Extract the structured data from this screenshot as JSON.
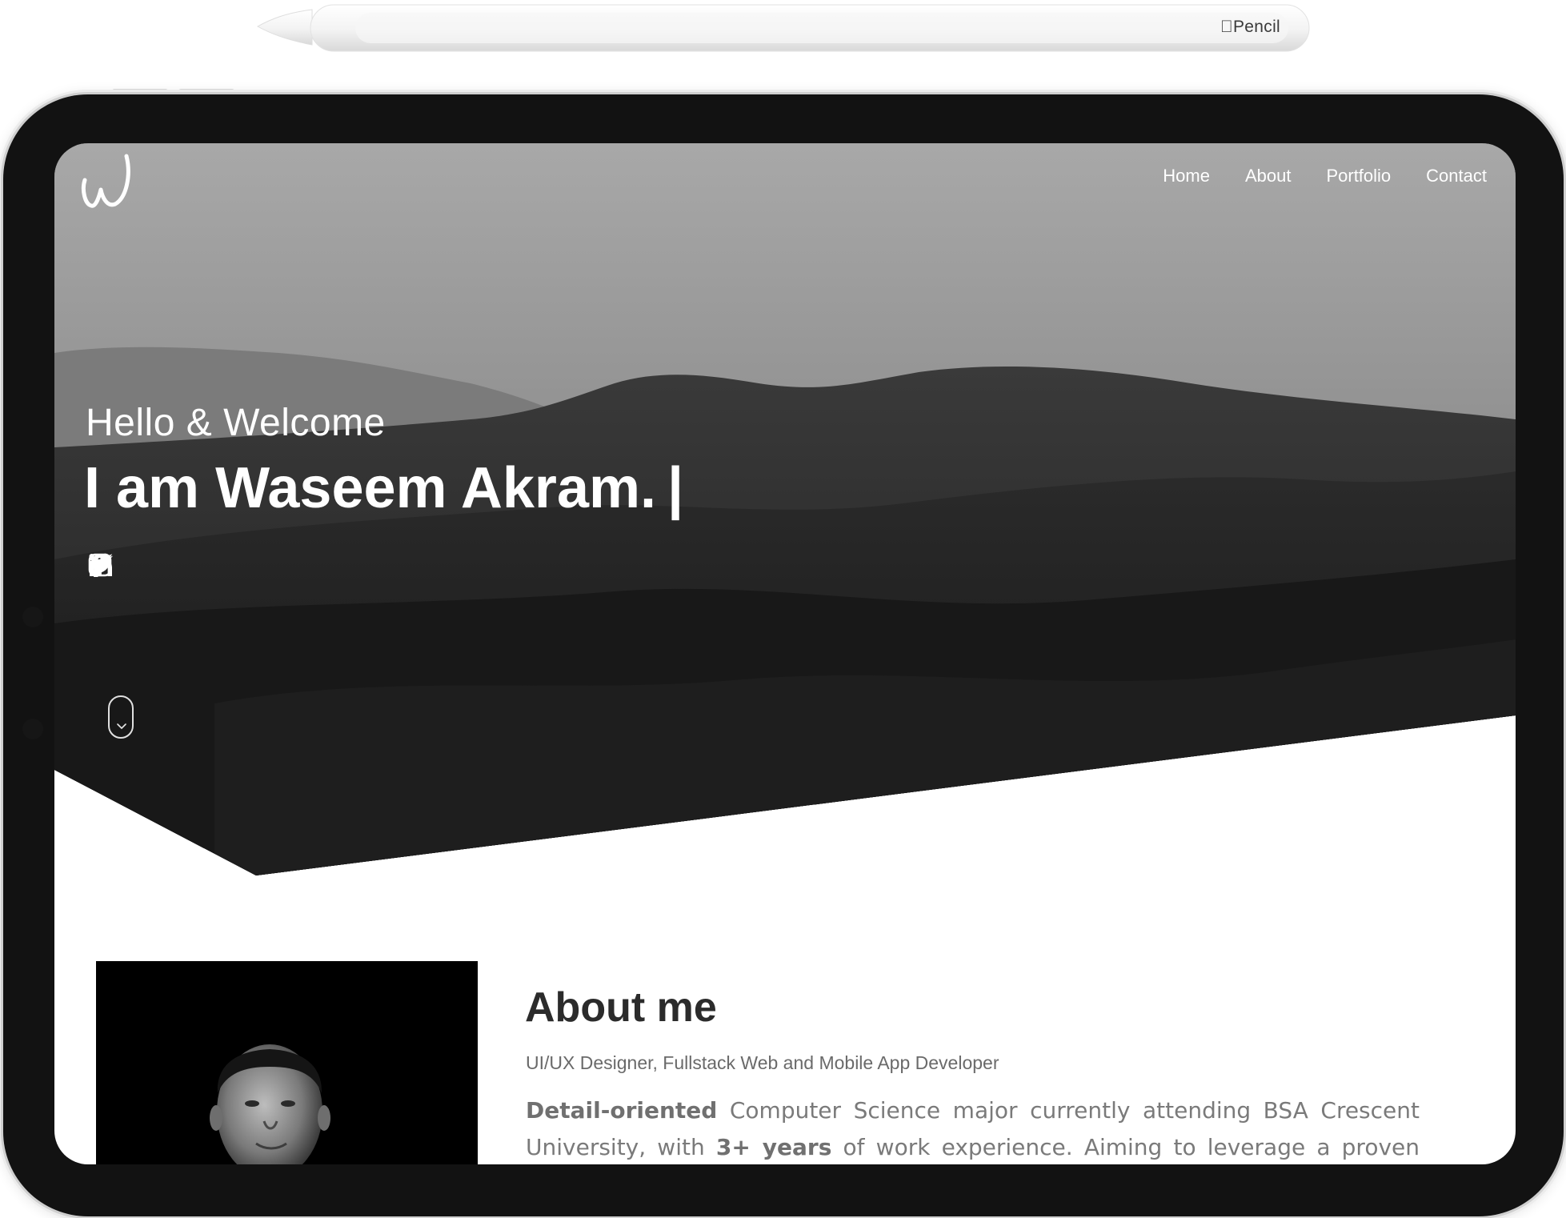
{
  "pencil": {
    "brand_label": "Pencil",
    "brand_icon": "apple-logo-icon"
  },
  "site": {
    "logo_icon": "w-monogram-logo",
    "nav": [
      {
        "label": "Home"
      },
      {
        "label": "About"
      },
      {
        "label": "Portfolio"
      },
      {
        "label": "Contact"
      }
    ]
  },
  "hero": {
    "greeting": "Hello & Welcome",
    "headline": "I am Waseem Akram.",
    "cursor": "|",
    "socials": [
      {
        "icon": "facebook-icon"
      },
      {
        "icon": "twitter-icon"
      },
      {
        "icon": "instagram-icon"
      },
      {
        "icon": "linkedin-icon"
      }
    ],
    "scroll_icon": "chevron-down-icon"
  },
  "about": {
    "title": "About me",
    "subtitle": "UI/UX Designer, Fullstack Web and Mobile App Developer",
    "body": {
      "bold_1": "Detail-oriented",
      "text_1": " Computer Science major currently attending BSA Crescent University, with ",
      "bold_2": "3+ years",
      "text_2": " of work experience. Aiming to leverage a proven"
    }
  },
  "colors": {
    "device_frame": "#121212",
    "hero_text": "#ffffff",
    "heading_dark": "#2b2b2b",
    "body_gray": "#7a7a7a"
  }
}
